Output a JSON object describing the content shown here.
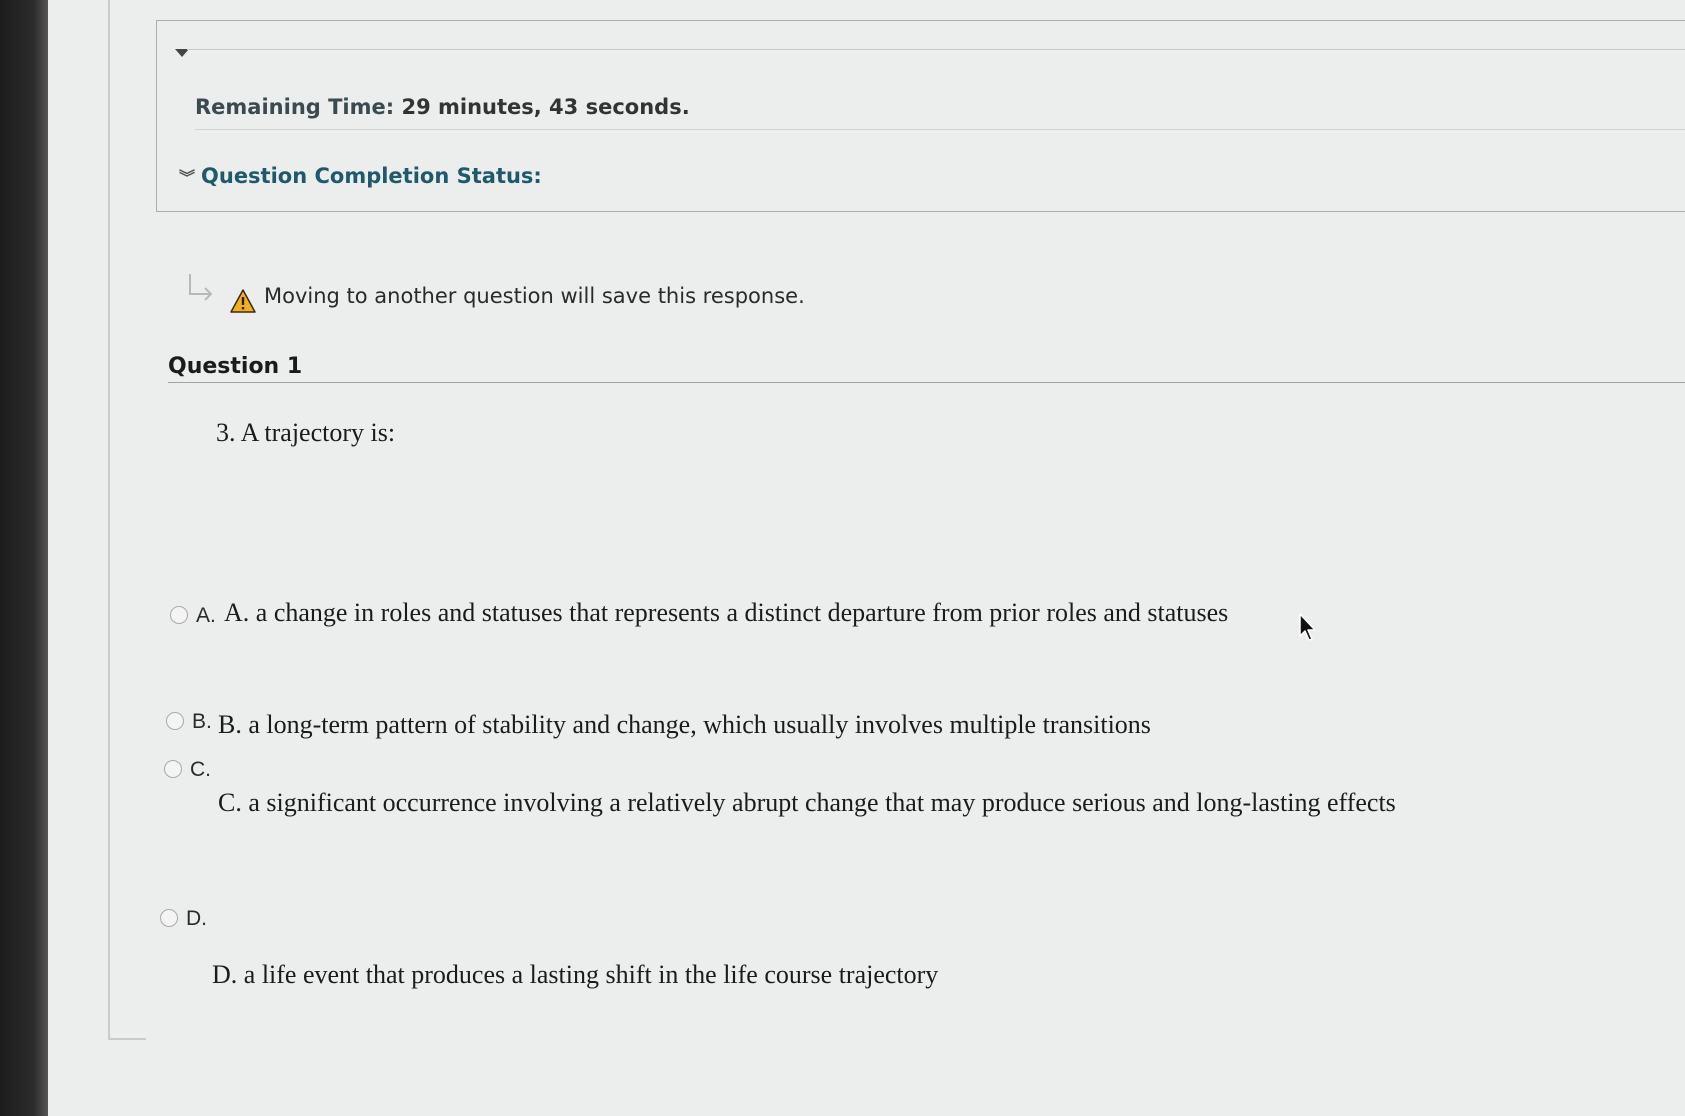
{
  "status_panel": {
    "timer_label": "Remaining Time:",
    "timer_value": "29 minutes, 43 seconds.",
    "completion_label": "Question Completion Status:"
  },
  "notice": {
    "text": "Moving to another question will save this response."
  },
  "question": {
    "heading": "Question 1",
    "prompt": "3. A trajectory is:"
  },
  "options": [
    {
      "letter": "A.",
      "text": "A. a change in roles and statuses that represents a distinct departure from prior roles and statuses",
      "selected": false
    },
    {
      "letter": "B.",
      "text": "B. a long-term pattern of stability and change, which usually involves multiple transitions",
      "selected": false
    },
    {
      "letter": "C.",
      "text": "C. a significant occurrence involving a relatively abrupt change that may produce serious and long-lasting effects",
      "selected": false
    },
    {
      "letter": "D.",
      "text": "D. a life event that produces a lasting shift in the life course trajectory",
      "selected": false
    }
  ],
  "icons": {
    "toggle": "triangle-down-icon",
    "completion_chevron": "double-chevron-down-icon",
    "arrow": "return-arrow-icon",
    "warning": "warning-icon",
    "cursor": "mouse-pointer-icon"
  },
  "colors": {
    "completion_text": "#1d5a6b",
    "warning_fill": "#f2b01e"
  }
}
